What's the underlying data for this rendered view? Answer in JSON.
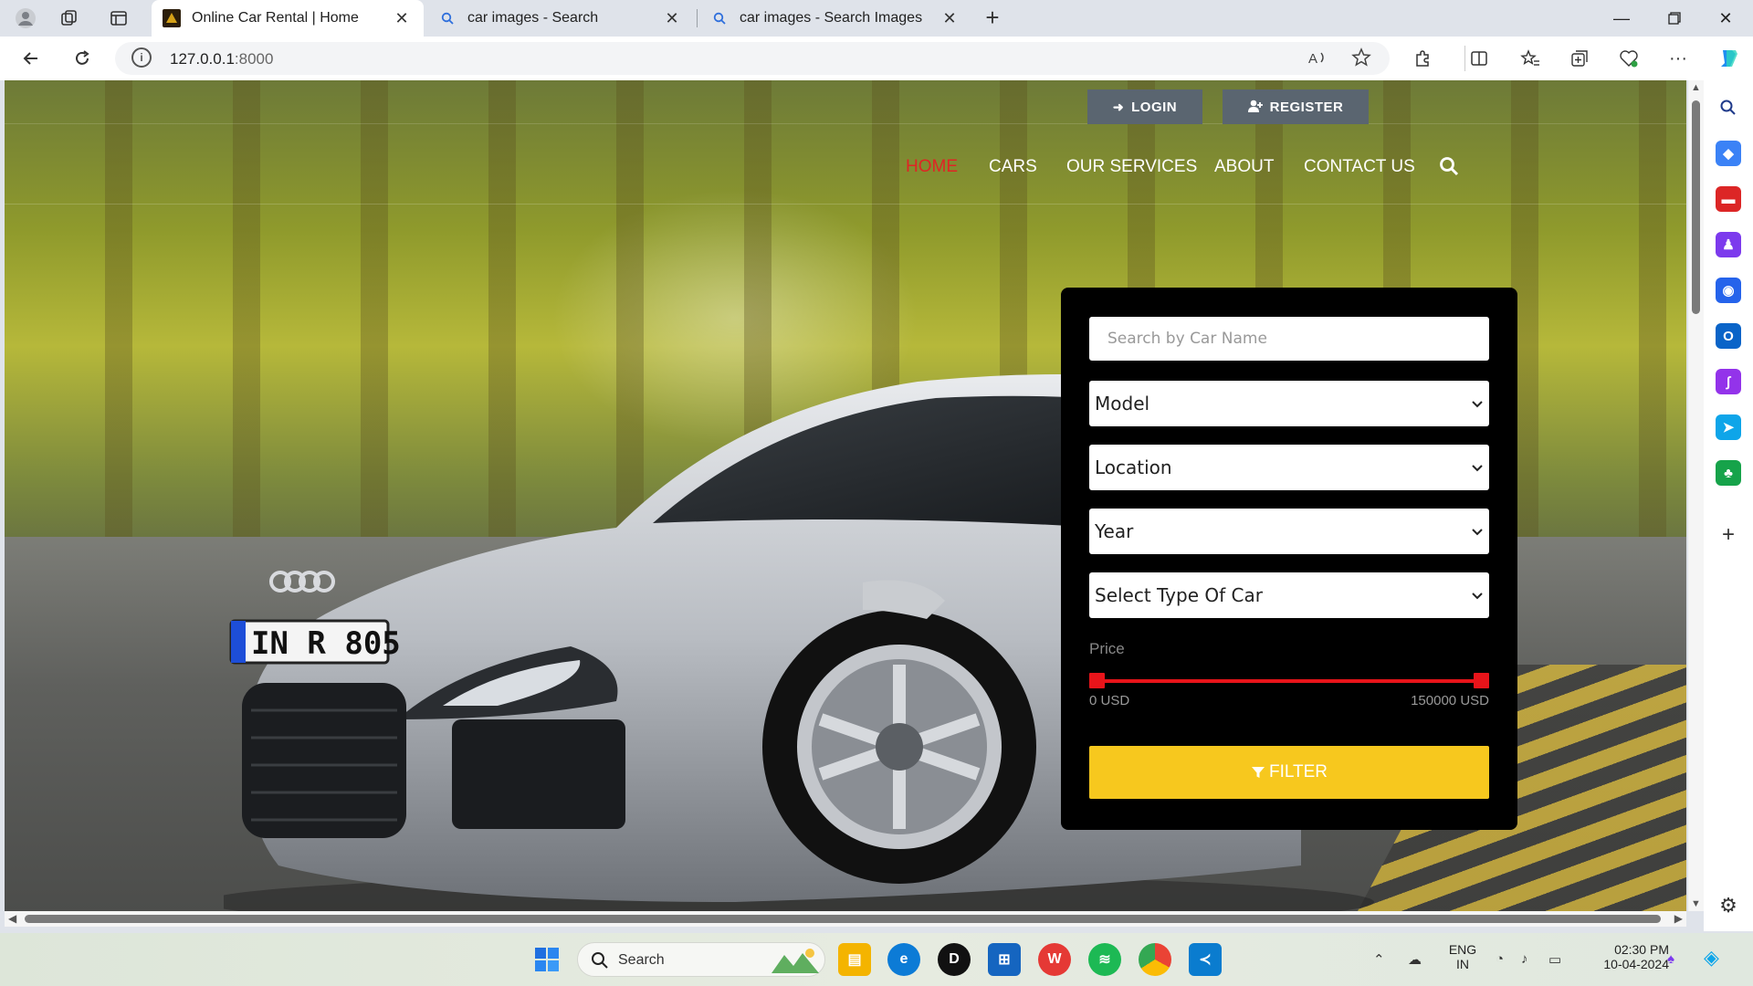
{
  "browser": {
    "tabs": [
      {
        "title": "Online Car Rental | Home",
        "active": true,
        "icon": "site-logo-icon"
      },
      {
        "title": "car images - Search",
        "active": false,
        "icon": "search-icon"
      },
      {
        "title": "car images - Search Images",
        "active": false,
        "icon": "search-icon"
      }
    ],
    "url_host": "127.0.0.1",
    "url_port": ":8000"
  },
  "site": {
    "auth": {
      "login_label": "LOGIN",
      "register_label": "REGISTER"
    },
    "nav": [
      {
        "label": "HOME",
        "active": true
      },
      {
        "label": "CARS",
        "active": false
      },
      {
        "label": "OUR SERVICES",
        "active": false
      },
      {
        "label": "ABOUT",
        "active": false
      },
      {
        "label": "CONTACT US",
        "active": false
      }
    ],
    "plate_text": "IN R 805",
    "filter": {
      "search_placeholder": "Search by Car Name",
      "model": "Model",
      "location": "Location",
      "year": "Year",
      "car_type": "Select Type Of Car",
      "price_label": "Price",
      "price_min": "0 USD",
      "price_max": "150000 USD",
      "price_range": [
        0,
        150000
      ],
      "button_label": "FILTER"
    },
    "colors": {
      "active_nav": "#e02424",
      "filter_button": "#f7c81e",
      "slider": "#e8141a"
    }
  },
  "taskbar": {
    "search_label": "Search",
    "language": "ENG",
    "region": "IN",
    "time": "02:30 PM",
    "date": "10-04-2024"
  }
}
